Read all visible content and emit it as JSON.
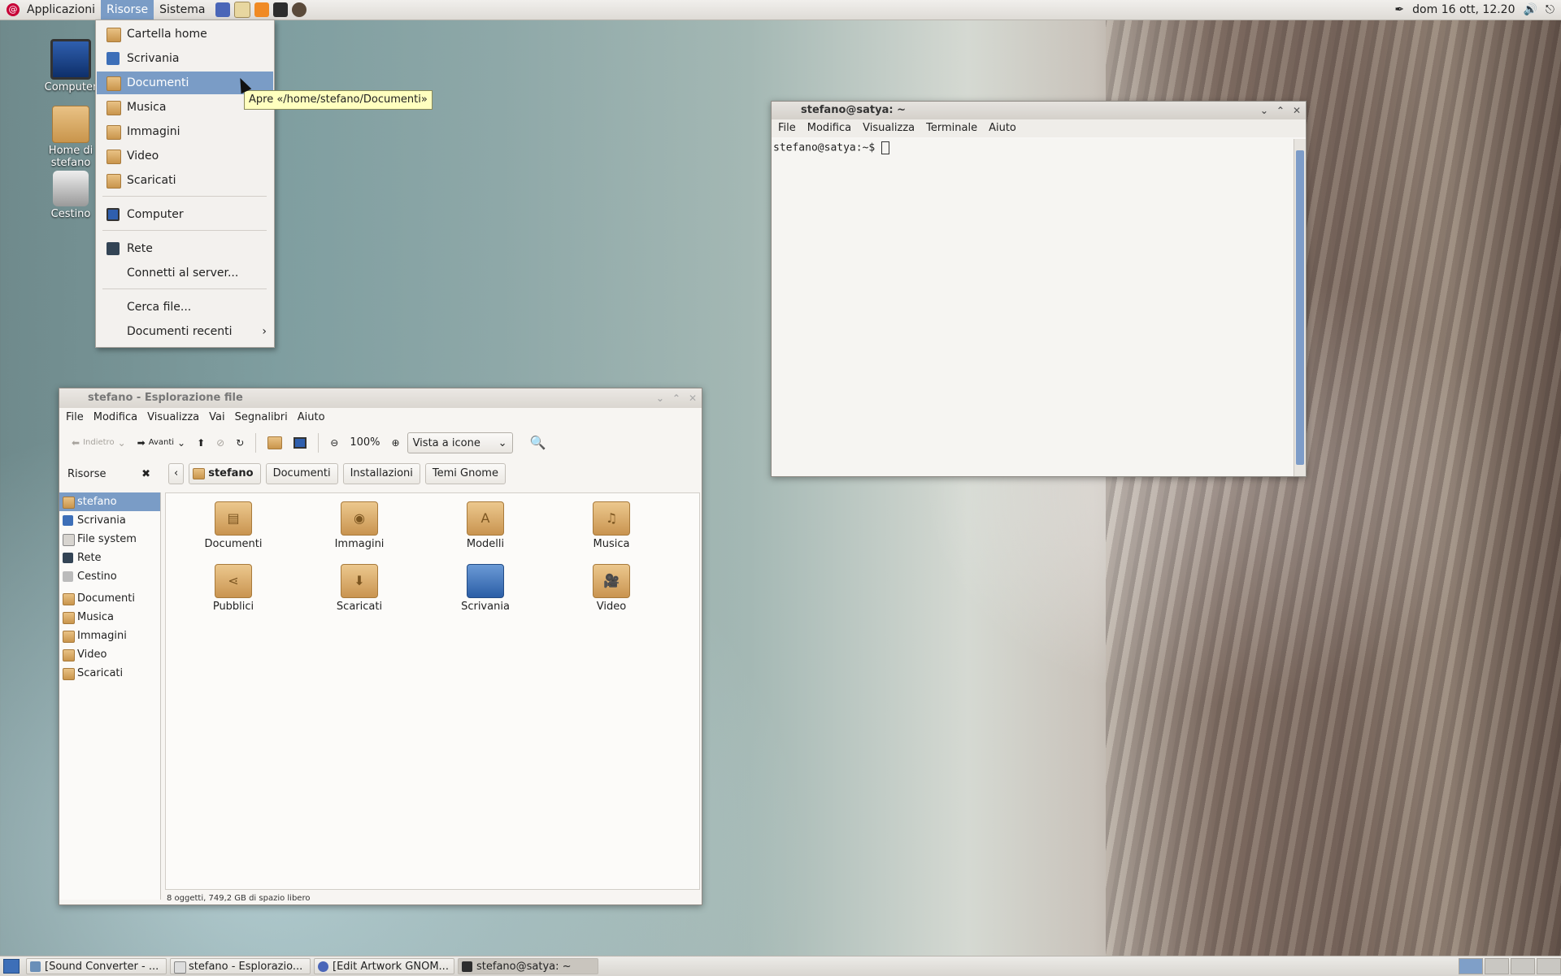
{
  "top_panel": {
    "menus": [
      "Applicazioni",
      "Risorse",
      "Sistema"
    ],
    "clock": "dom 16 ott, 12.20",
    "launchers": [
      "browser-icon",
      "calendar-icon",
      "rss-icon",
      "terminal-icon",
      "camera-icon"
    ]
  },
  "desktop_icons": [
    {
      "label": "Computer",
      "icon": "computer-icon"
    },
    {
      "label": "Home di stefano",
      "icon": "home-folder-icon"
    },
    {
      "label": "Cestino",
      "icon": "trash-icon"
    }
  ],
  "places_menu": {
    "items": [
      {
        "label": "Cartella home"
      },
      {
        "label": "Scrivania"
      },
      {
        "label": "Documenti"
      },
      {
        "label": "Musica"
      },
      {
        "label": "Immagini"
      },
      {
        "label": "Video"
      },
      {
        "label": "Scaricati"
      },
      {
        "label": "Computer"
      },
      {
        "label": "Rete"
      },
      {
        "label": "Connetti al server..."
      },
      {
        "label": "Cerca file..."
      },
      {
        "label": "Documenti recenti"
      }
    ],
    "selected": "Documenti",
    "tooltip": "Apre «/home/stefano/Documenti»"
  },
  "terminal": {
    "title": "stefano@satya: ~",
    "menu": [
      "File",
      "Modifica",
      "Visualizza",
      "Terminale",
      "Aiuto"
    ],
    "prompt": "stefano@satya:~$ "
  },
  "file_manager": {
    "title": "stefano - Esplorazione file",
    "menu": [
      "File",
      "Modifica",
      "Visualizza",
      "Vai",
      "Segnalibri",
      "Aiuto"
    ],
    "toolbar": {
      "back": "Indietro",
      "forward": "Avanti",
      "zoom": "100%",
      "view": "Vista a icone"
    },
    "side_header": "Risorse",
    "breadcrumbs": [
      "stefano",
      "Documenti",
      "Installazioni",
      "Temi Gnome"
    ],
    "sidebar": [
      "stefano",
      "Scrivania",
      "File system",
      "Rete",
      "Cestino",
      "Documenti",
      "Musica",
      "Immagini",
      "Video",
      "Scaricati"
    ],
    "files": [
      {
        "name": "Documenti",
        "icon": "documents-folder-icon"
      },
      {
        "name": "Immagini",
        "icon": "pictures-folder-icon"
      },
      {
        "name": "Modelli",
        "icon": "templates-folder-icon"
      },
      {
        "name": "Musica",
        "icon": "music-folder-icon"
      },
      {
        "name": "Pubblici",
        "icon": "public-folder-icon"
      },
      {
        "name": "Scaricati",
        "icon": "downloads-folder-icon"
      },
      {
        "name": "Scrivania",
        "icon": "desktop-icon"
      },
      {
        "name": "Video",
        "icon": "video-folder-icon"
      }
    ],
    "status": "8 oggetti, 749,2 GB di spazio libero"
  },
  "taskbar": [
    {
      "label": "[Sound Converter - ...",
      "icon": "sound-converter-icon"
    },
    {
      "label": "stefano - Esplorazio...",
      "icon": "file-manager-icon"
    },
    {
      "label": "[Edit Artwork GNOM...",
      "icon": "browser-icon"
    },
    {
      "label": "stefano@satya: ~",
      "icon": "terminal-icon"
    }
  ],
  "colors": {
    "selection": "#7a9cc6",
    "folder": "#d3a25e",
    "tooltip": "#ffffbf"
  }
}
